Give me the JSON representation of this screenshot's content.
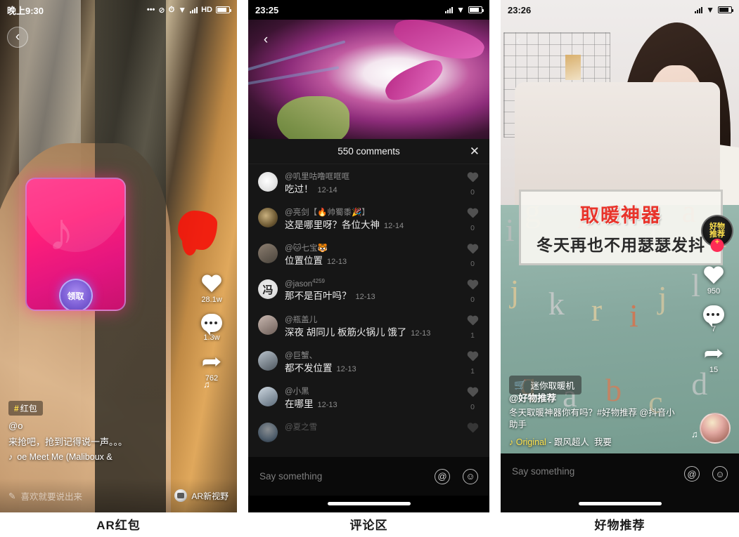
{
  "panels": [
    {
      "caption": "AR红包"
    },
    {
      "caption": "评论区"
    },
    {
      "caption": "好物推荐"
    }
  ],
  "phone1": {
    "status": {
      "time": "晚上9:30",
      "hd": "HD",
      "icons": [
        "dots-icon",
        "mute-icon",
        "alarm-icon",
        "wifi-icon",
        "signal-icon",
        "hd-label",
        "battery-icon"
      ]
    },
    "back_icon": "back-chevron-icon",
    "redpacket": {
      "claim_label": "领取",
      "logo": "tiktok-note-icon"
    },
    "rail": {
      "like_count": "28.1w",
      "comment_count": "1.3w",
      "share_count": "762",
      "music_disc": "music-disc-icon"
    },
    "caption": {
      "hashtag": "红包",
      "hash_symbol": "#",
      "user": "@o",
      "desc": "来抢吧，抢到记得说一声。。。",
      "music_icon": "tiktok-music-icon",
      "music": "oe    Meet Me (Maliboux &"
    },
    "bottom": {
      "input_placeholder": "喜欢就要说出来",
      "pencil_icon": "pencil-icon",
      "ar_label": "AR新视野",
      "ar_icon": "ar-lens-icon"
    }
  },
  "phone2": {
    "status": {
      "time": "23:25",
      "icons": [
        "signal-icon",
        "wifi-icon",
        "battery-icon"
      ]
    },
    "back_icon": "back-chevron-icon",
    "header": {
      "title": "550 comments",
      "close_icon": "close-icon"
    },
    "comments": [
      {
        "user": "@叽里咕噜哐哐哐",
        "text": "吃过！",
        "date": "12-14",
        "likes": "0",
        "avatar": "avatar-0"
      },
      {
        "user": "@亮剑【🔥帅蜀黍🎉】",
        "text": "这是哪里呀？各位大神",
        "date": "12-14",
        "likes": "0",
        "avatar": "avatar-1"
      },
      {
        "user": "@🐱七宝🐯",
        "text": "位置位置",
        "date": "12-13",
        "likes": "0",
        "avatar": "avatar-2"
      },
      {
        "user": "@jason",
        "sup": "4259",
        "text": "那不是百叶吗？",
        "date": "12-13",
        "likes": "0",
        "avatar": "avatar-3",
        "avatar_char": "冯"
      },
      {
        "user": "@瓶盖儿",
        "text": "深夜 胡同儿 板筋火锅儿 饿了",
        "date": "12-13",
        "likes": "1",
        "avatar": "avatar-4"
      },
      {
        "user": "@巨蟹、",
        "text": "都不发位置",
        "date": "12-13",
        "likes": "1",
        "avatar": "avatar-5"
      },
      {
        "user": "@小黑",
        "text": "在哪里",
        "date": "12-13",
        "likes": "0",
        "avatar": "avatar-6"
      },
      {
        "user": "@夏之雪",
        "text": "",
        "date": "",
        "likes": "",
        "avatar": "avatar-7"
      }
    ],
    "say_bar": {
      "placeholder": "Say something",
      "at_icon": "at-icon",
      "emoji_icon": "emoji-icon"
    }
  },
  "phone3": {
    "status": {
      "time": "23:26",
      "icons": [
        "signal-icon",
        "wifi-icon",
        "battery-icon"
      ]
    },
    "back_icon": "back-chevron-icon",
    "promo": {
      "line1": "取暖神器",
      "line2": "冬天再也不用瑟瑟发抖"
    },
    "badge": {
      "line1": "好物",
      "line2": "推荐",
      "plus": "+"
    },
    "product_tag": {
      "label": "迷你取暖机",
      "icon": "shopping-cart-icon"
    },
    "rail": {
      "like_count": "950",
      "comment_count": "7",
      "share_count": "15",
      "music_disc": "music-disc-icon"
    },
    "caption": {
      "user": "@好物推荐",
      "desc": "冬天取暖神器你有吗？#好物推荐 @抖音小助手",
      "music_icon": "tiktok-music-icon",
      "music_original": "Original",
      "music_sep": " - ",
      "music_artist": "跟风超人",
      "music_extra": "我要"
    },
    "bottom": {
      "placeholder": "Say something",
      "at_icon": "at-icon",
      "emoji_icon": "emoji-icon"
    }
  },
  "colors": {
    "accent_red": "#fe2c55",
    "promo_red": "#e8342b",
    "badge_yellow": "#ffe24d"
  }
}
